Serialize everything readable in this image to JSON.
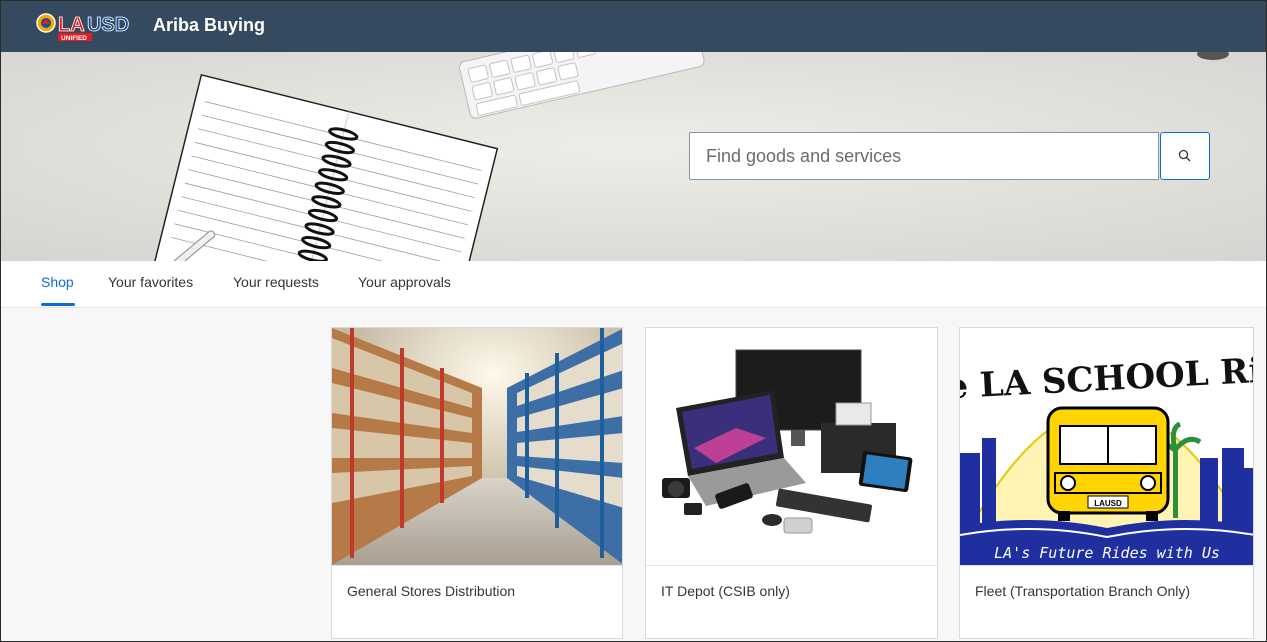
{
  "header": {
    "logo_text": "LAUSD",
    "logo_subtext": "UNIFIED",
    "app_title": "Ariba Buying",
    "background_color": "#354a5f"
  },
  "search": {
    "placeholder": "Find goods and services",
    "value": "",
    "button_icon": "search-icon"
  },
  "tabs": [
    {
      "label": "Shop",
      "active": true
    },
    {
      "label": "Your favorites",
      "active": false
    },
    {
      "label": "Your requests",
      "active": false
    },
    {
      "label": "Your approvals",
      "active": false
    }
  ],
  "tiles": [
    {
      "label": "General Stores Distribution",
      "image": "warehouse-shelves-image"
    },
    {
      "label": "IT Depot (CSIB only)",
      "image": "electronics-devices-image"
    },
    {
      "label": "Fleet (Transportation Branch Only)",
      "image": "la-school-ride-logo-image",
      "logo_top_text": "the LA SCHOOL Ride",
      "logo_bottom_text": "LA's Future Rides with Us",
      "bus_plate": "LAUSD"
    }
  ],
  "colors": {
    "accent": "#0a6ed1",
    "text": "#32363a"
  }
}
